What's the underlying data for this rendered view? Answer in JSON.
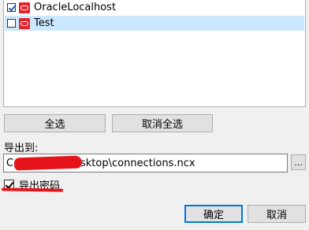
{
  "connections": [
    {
      "label": "OracleLocalhost",
      "checked": true,
      "icon": "oracle-db-icon"
    },
    {
      "label": "Test",
      "checked": false,
      "icon": "oracle-db-icon"
    }
  ],
  "buttons": {
    "select_all": "全选",
    "deselect_all": "取消全选",
    "browse": "...",
    "ok": "确定",
    "cancel": "取消"
  },
  "export": {
    "label": "导出到:",
    "path": "C:\\Users\\…\\Desktop\\connections.ncx"
  },
  "export_password": {
    "label": "导出密码",
    "checked": true
  },
  "colors": {
    "oracle_icon": "#e2232b",
    "selection": "#cce8ff",
    "annotation": "#e5141a"
  }
}
